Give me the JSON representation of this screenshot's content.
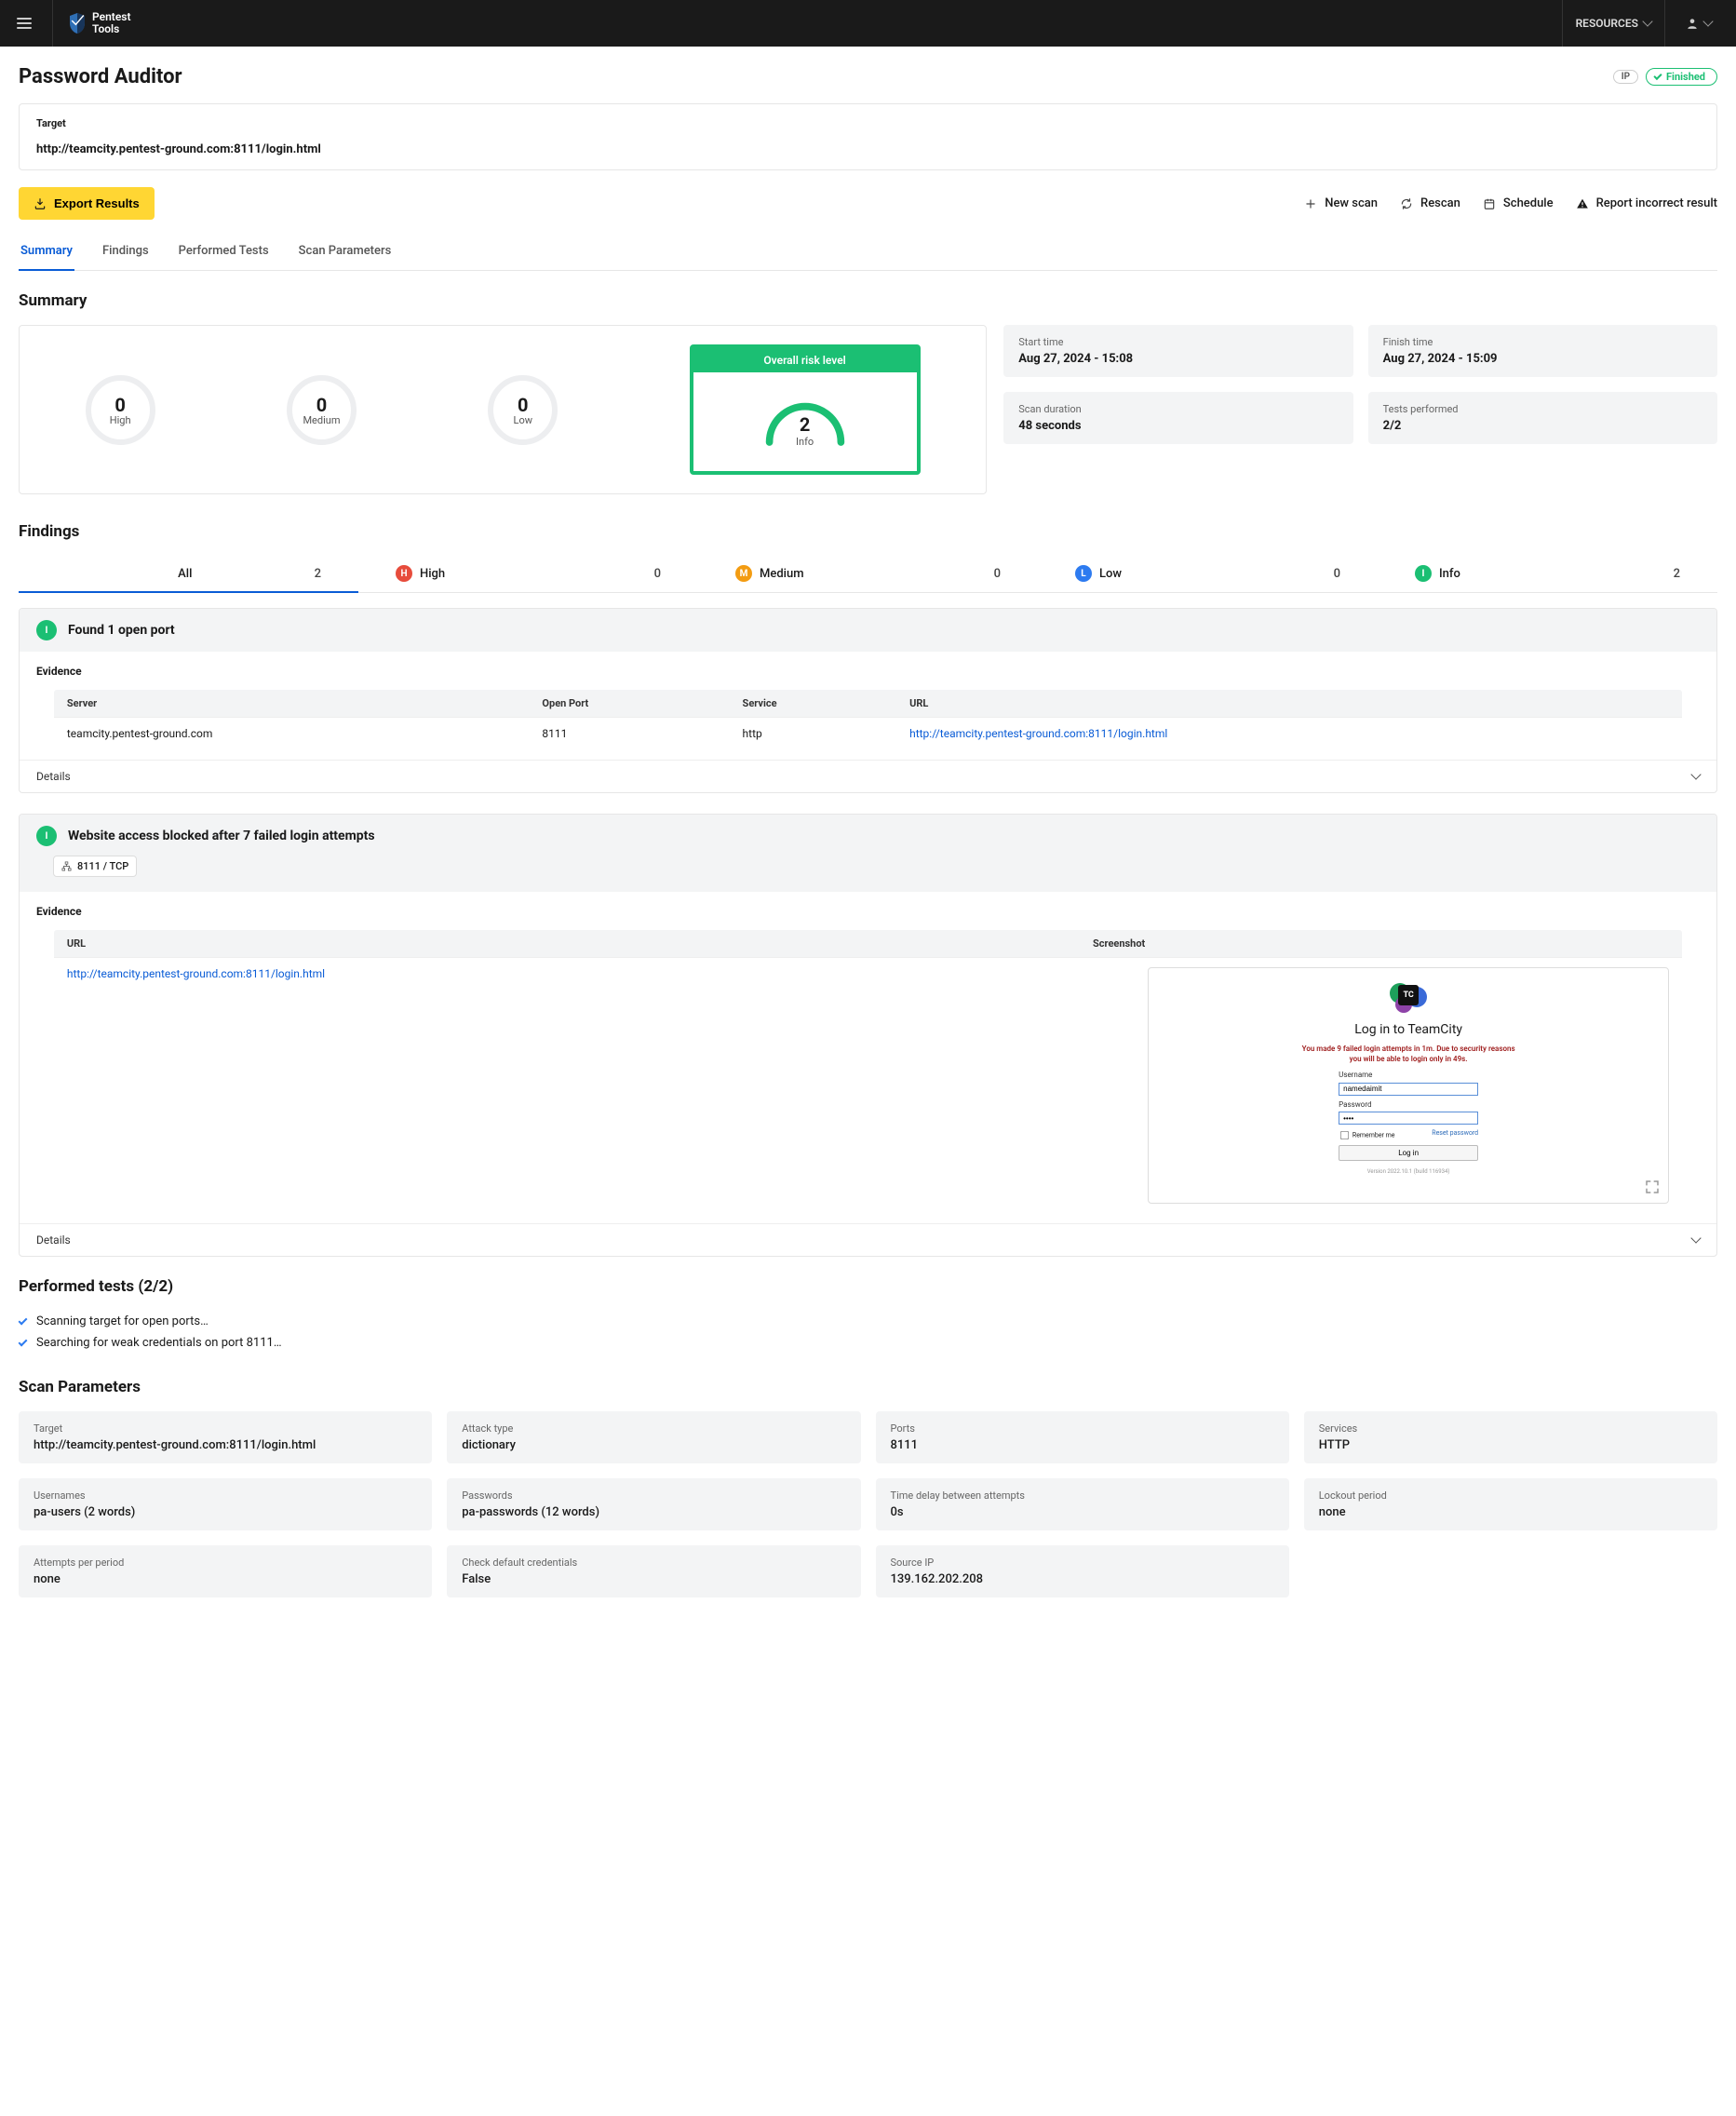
{
  "topbar": {
    "brand1": "Pentest",
    "brand2": "Tools",
    "resources": "RESOURCES"
  },
  "page_title": "Password Auditor",
  "badges": {
    "ip": "IP",
    "finished": "Finished"
  },
  "target_card": {
    "label": "Target",
    "value": "http://teamcity.pentest-ground.com:8111/login.html"
  },
  "toolbar": {
    "export": "Export Results",
    "new_scan": "New scan",
    "rescan": "Rescan",
    "schedule": "Schedule",
    "report": "Report incorrect result"
  },
  "tabs": [
    "Summary",
    "Findings",
    "Performed Tests",
    "Scan Parameters"
  ],
  "summary": {
    "heading": "Summary",
    "gauges": [
      {
        "num": "0",
        "label": "High"
      },
      {
        "num": "0",
        "label": "Medium"
      },
      {
        "num": "0",
        "label": "Low"
      }
    ],
    "overall": {
      "title": "Overall risk level",
      "num": "2",
      "label": "Info"
    },
    "meta": {
      "start_l": "Start time",
      "start_v": "Aug 27, 2024 - 15:08",
      "finish_l": "Finish time",
      "finish_v": "Aug 27, 2024 - 15:09",
      "dur_l": "Scan duration",
      "dur_v": "48 seconds",
      "tests_l": "Tests performed",
      "tests_v": "2/2"
    }
  },
  "findings": {
    "heading": "Findings",
    "filters": {
      "all_l": "All",
      "all_c": "2",
      "h_b": "H",
      "h_l": "High",
      "h_c": "0",
      "m_b": "M",
      "m_l": "Medium",
      "m_c": "0",
      "l_b": "L",
      "l_l": "Low",
      "l_c": "0",
      "i_b": "I",
      "i_l": "Info",
      "i_c": "2"
    },
    "f1": {
      "badge": "I",
      "title": "Found 1 open port",
      "evidence_h": "Evidence",
      "cols": {
        "c1": "Server",
        "c2": "Open Port",
        "c3": "Service",
        "c4": "URL"
      },
      "row": {
        "server": "teamcity.pentest-ground.com",
        "port": "8111",
        "service": "http",
        "url": "http://teamcity.pentest-ground.com:8111/login.html"
      },
      "details": "Details"
    },
    "f2": {
      "badge": "I",
      "title": "Website access blocked after 7 failed login attempts",
      "chip": "8111 / TCP",
      "evidence_h": "Evidence",
      "cols": {
        "c1": "URL",
        "c2": "Screenshot"
      },
      "url": "http://teamcity.pentest-ground.com:8111/login.html",
      "tc": {
        "logo_txt": "TC",
        "heading": "Log in to TeamCity",
        "err1": "You made 9 failed login attempts in 1m. Due to security reasons",
        "err2": "you will be able to login only in 49s.",
        "user_l": "Username",
        "user_v": "namedaimit",
        "pass_l": "Password",
        "pass_v": "••••",
        "remember": "Remember me",
        "reset": "Reset password",
        "login_btn": "Log in",
        "version": "Version 2022.10.1 (build 116934)"
      },
      "details": "Details"
    }
  },
  "performed": {
    "heading": "Performed tests (2/2)",
    "items": [
      "Scanning target for open ports…",
      "Searching for weak credentials on port 8111…"
    ]
  },
  "params": {
    "heading": "Scan Parameters",
    "rows": [
      {
        "l": "Target",
        "v": "http://teamcity.pentest-ground.com:8111/login.html"
      },
      {
        "l": "Attack type",
        "v": "dictionary"
      },
      {
        "l": "Ports",
        "v": "8111"
      },
      {
        "l": "Services",
        "v": "HTTP"
      },
      {
        "l": "Usernames",
        "v": "pa-users (2 words)"
      },
      {
        "l": "Passwords",
        "v": "pa-passwords (12 words)"
      },
      {
        "l": "Time delay between attempts",
        "v": "0s"
      },
      {
        "l": "Lockout period",
        "v": "none"
      },
      {
        "l": "Attempts per period",
        "v": "none"
      },
      {
        "l": "Check default credentials",
        "v": "False"
      },
      {
        "l": "Source IP",
        "v": "139.162.202.208"
      }
    ]
  }
}
